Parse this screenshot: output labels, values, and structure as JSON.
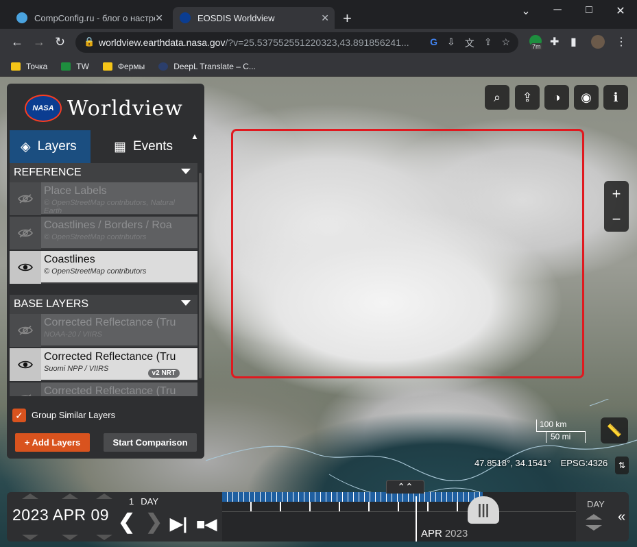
{
  "browser": {
    "tabs": [
      {
        "title": "CompConfig.ru - блог о настрой",
        "favicon_color": "#4aa3df"
      },
      {
        "title": "EOSDIS Worldview",
        "favicon_color": "#0b3d91"
      }
    ],
    "new_tab": "+",
    "window": {
      "minimize": "─",
      "maximize": "□",
      "close": "✕",
      "dropdown": "⌄"
    },
    "url_host": "worldview.earthdata.nasa.gov",
    "url_rest": "/?v=25.537552551220323,43.891856241...",
    "profile_badge": "7m",
    "bookmarks": [
      {
        "label": "Точка",
        "icon": "folder-icon"
      },
      {
        "label": "TW",
        "icon": "tw-icon"
      },
      {
        "label": "Фермы",
        "icon": "folder-icon"
      },
      {
        "label": "DeepL Translate – C...",
        "icon": "deepl-icon"
      }
    ]
  },
  "panel": {
    "logo_text": "NASA",
    "title": "Worldview",
    "tabs": [
      {
        "label": "Layers",
        "icon": "layers-icon",
        "active": true
      },
      {
        "label": "Events",
        "icon": "calendar-icon",
        "active": false
      }
    ],
    "sections": [
      {
        "title": "REFERENCE",
        "layers": [
          {
            "title": "Place Labels",
            "subtitle": "© OpenStreetMap contributors, Natural Earth",
            "visible": false
          },
          {
            "title": "Coastlines / Borders / Roa",
            "subtitle": "© OpenStreetMap contributors",
            "visible": false
          },
          {
            "title": "Coastlines",
            "subtitle": "© OpenStreetMap contributors",
            "visible": true
          }
        ]
      },
      {
        "title": "BASE LAYERS",
        "layers": [
          {
            "title": "Corrected Reflectance (Tru",
            "subtitle": "NOAA-20 / VIIRS",
            "visible": false
          },
          {
            "title": "Corrected Reflectance (Tru",
            "subtitle": "Suomi NPP / VIIRS",
            "visible": true,
            "badge": "v2 NRT"
          },
          {
            "title": "Corrected Reflectance (Tru",
            "subtitle": "",
            "visible": false
          }
        ]
      }
    ],
    "group_label": "Group Similar Layers",
    "group_checked": true,
    "add_layers": "+ Add Layers",
    "start_comparison": "Start Comparison"
  },
  "map": {
    "scale_km": "100 km",
    "scale_mi": "50 mi",
    "coords": "47.8518°, 34.1541°",
    "projection": "EPSG:4326",
    "zoom_in": "+",
    "zoom_out": "−",
    "tools": [
      {
        "name": "zoom-search-icon",
        "glyph": "🔍"
      },
      {
        "name": "share-icon",
        "glyph": "⇪"
      },
      {
        "name": "projection-icon",
        "glyph": "◑"
      },
      {
        "name": "camera-icon",
        "glyph": "📷"
      },
      {
        "name": "info-icon",
        "glyph": "ℹ"
      }
    ]
  },
  "timeline": {
    "date": "2023 APR 09",
    "interval_value": "1",
    "interval_unit": "DAY",
    "month": "APR",
    "year": "2023",
    "zoom_level": "DAY",
    "handle_glyph": "|||",
    "expand_glyph": "⌃⌃",
    "hide_glyph": "«"
  },
  "colors": {
    "accent": "#d9531e",
    "active_tab": "#1b4e80",
    "selection": "#e0191f",
    "timeline_tick": "#1f5fa0"
  }
}
